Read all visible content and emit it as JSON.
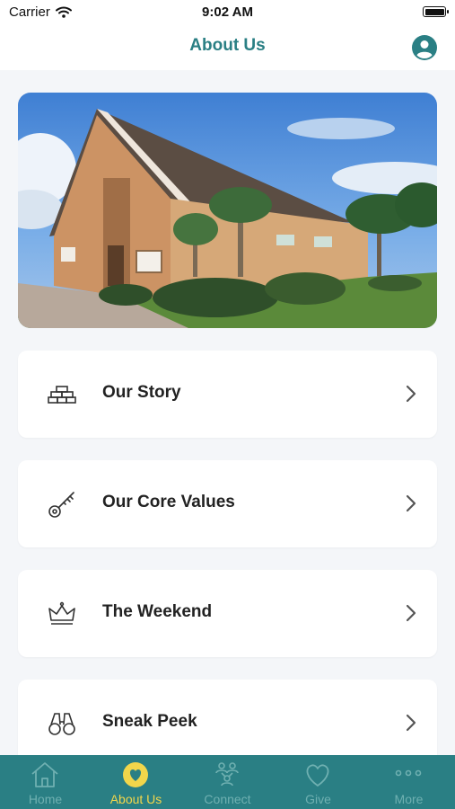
{
  "status": {
    "carrier": "Carrier",
    "time": "9:02 AM"
  },
  "nav": {
    "title": "About Us"
  },
  "menu": [
    {
      "label": "Our Story",
      "icon": "brick-wall-icon"
    },
    {
      "label": "Our Core Values",
      "icon": "key-icon"
    },
    {
      "label": "The Weekend",
      "icon": "crown-icon"
    },
    {
      "label": "Sneak Peek",
      "icon": "binoculars-icon"
    }
  ],
  "tabs": [
    {
      "label": "Home",
      "icon": "home-icon",
      "active": false
    },
    {
      "label": "About Us",
      "icon": "heart-circle-icon",
      "active": true
    },
    {
      "label": "Connect",
      "icon": "people-network-icon",
      "active": false
    },
    {
      "label": "Give",
      "icon": "heart-outline-icon",
      "active": false
    },
    {
      "label": "More",
      "icon": "ellipsis-icon",
      "active": false
    }
  ],
  "colors": {
    "accent": "#2a7f84",
    "active_tab": "#f2d64b",
    "inactive_tab": "#6fb0b1"
  }
}
